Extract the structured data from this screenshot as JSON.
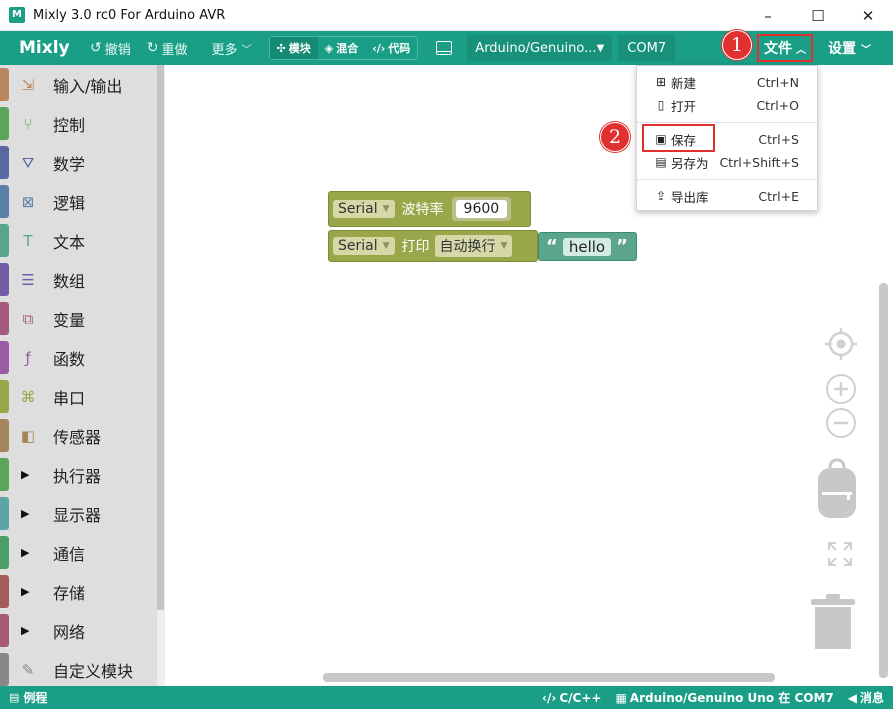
{
  "window": {
    "title": "Mixly 3.0 rc0 For Arduino AVR",
    "icon_text": "M",
    "controls": [
      "–",
      "☐",
      "✕"
    ]
  },
  "toolbar": {
    "logo": "Mixly",
    "undo_label": "撤销",
    "redo_label": "重做",
    "more_label": "更多",
    "modes": [
      "模块",
      "混合",
      "代码"
    ],
    "board": "Arduino/Genuino...",
    "port": "COM7",
    "file_label": "文件",
    "settings_label": "设置"
  },
  "badges": {
    "one": "1",
    "two": "2"
  },
  "sidebar": {
    "items": [
      {
        "label": "输入/输出",
        "icon": "input-output-icon",
        "glyph": "⇲",
        "color": "#b8865f"
      },
      {
        "label": "控制",
        "icon": "control-icon",
        "glyph": "⑂",
        "color": "#5ba55b"
      },
      {
        "label": "数学",
        "icon": "math-icon",
        "glyph": "⛛",
        "color": "#5b67a5"
      },
      {
        "label": "逻辑",
        "icon": "logic-icon",
        "glyph": "⊠",
        "color": "#5b80a5"
      },
      {
        "label": "文本",
        "icon": "text-icon",
        "glyph": "T",
        "color": "#5ba58c"
      },
      {
        "label": "数组",
        "icon": "list-icon",
        "glyph": "☰",
        "color": "#745ba5"
      },
      {
        "label": "变量",
        "icon": "variable-icon",
        "glyph": "⧉",
        "color": "#a55b80"
      },
      {
        "label": "函数",
        "icon": "function-icon",
        "glyph": "ƒ",
        "color": "#995ba5"
      },
      {
        "label": "串口",
        "icon": "serial-icon",
        "glyph": "⌘",
        "color": "#9aa64a"
      },
      {
        "label": "传感器",
        "icon": "sensor-icon",
        "glyph": "◧",
        "color": "#a5855b"
      },
      {
        "label": "执行器",
        "icon": "expand-triangle-icon",
        "glyph": "▶",
        "color": "#5ba55b"
      },
      {
        "label": "显示器",
        "icon": "expand-triangle-icon",
        "glyph": "▶",
        "color": "#5ba5a5"
      },
      {
        "label": "通信",
        "icon": "expand-triangle-icon",
        "glyph": "▶",
        "color": "#4ba06a"
      },
      {
        "label": "存储",
        "icon": "expand-triangle-icon",
        "glyph": "▶",
        "color": "#a55b5b"
      },
      {
        "label": "网络",
        "icon": "expand-triangle-icon",
        "glyph": "▶",
        "color": "#a55b6f"
      },
      {
        "label": "自定义模块",
        "icon": "custom-module-icon",
        "glyph": "✎",
        "color": "#888888"
      }
    ]
  },
  "blocks": {
    "baud": {
      "object": "Serial",
      "label": "波特率",
      "value": "9600"
    },
    "print": {
      "object": "Serial",
      "label": "打印",
      "mode": "自动换行",
      "text": "hello",
      "quote_open": "“",
      "quote_close": "”"
    }
  },
  "file_menu": {
    "items": [
      {
        "label": "新建",
        "shortcut": "Ctrl+N",
        "icon": "new-file-icon",
        "glyph": "⊞"
      },
      {
        "label": "打开",
        "shortcut": "Ctrl+O",
        "icon": "open-file-icon",
        "glyph": "▯"
      },
      {
        "label": "保存",
        "shortcut": "Ctrl+S",
        "icon": "save-icon",
        "glyph": "▣"
      },
      {
        "label": "另存为",
        "shortcut": "Ctrl+Shift+S",
        "icon": "save-as-icon",
        "glyph": "▤"
      },
      {
        "label": "导出库",
        "shortcut": "Ctrl+E",
        "icon": "export-library-icon",
        "glyph": "⇪"
      }
    ]
  },
  "statusbar": {
    "examples": "例程",
    "language": "C/C++",
    "board_port": "Arduino/Genuino Uno 在 COM7",
    "messages": "消息"
  },
  "colors": {
    "accent": "#1a9e86",
    "highlight": "#e03030",
    "serial_block": "#9aa64a",
    "text_block": "#5ba58c"
  }
}
